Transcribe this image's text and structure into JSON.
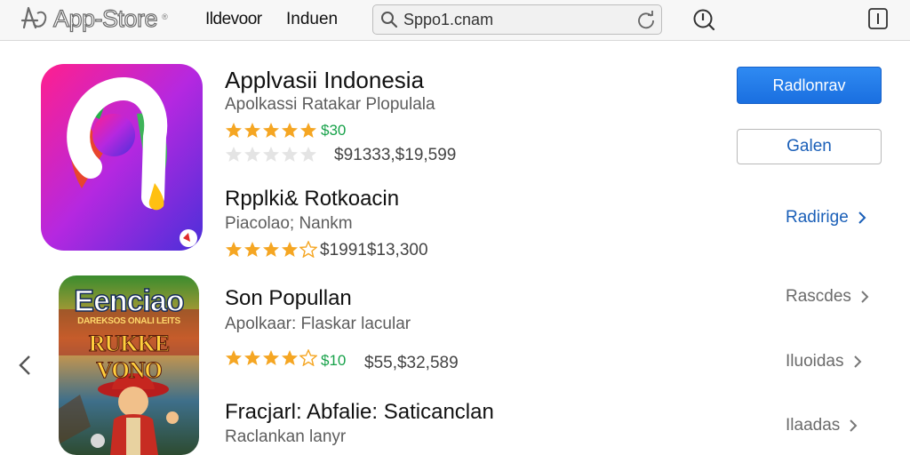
{
  "header": {
    "brand": "App-Store",
    "brand_mark": "®",
    "nav": [
      "Ildevoor",
      "Induen"
    ],
    "search": {
      "value": "Sppo1.cnam",
      "placeholder": ""
    }
  },
  "apps": [
    {
      "title": "Applvasii Indonesia",
      "subtitle": "Apolkassi Ratakar Plopulala",
      "rating_a": 5,
      "price_a": "$30",
      "rating_b": 0,
      "price_b": "$91333,$19,599",
      "primary_action": "Radlonrav",
      "secondary_action": "Galen"
    },
    {
      "title": "Rpplki& Rotkoacin",
      "subtitle": "Piacolao; Nankm",
      "rating": 4.5,
      "price": "$1991$13,300",
      "action": "Radirige"
    },
    {
      "title": "Son Popullan",
      "subtitle": "Apolkaar: Flaskar lacular",
      "rating": 4.5,
      "price_green": "$10",
      "price": "$55,$32,589",
      "action": "Rascdes",
      "action2": "Iluoidas"
    },
    {
      "title": "Fracjarl: Abfalie: Saticanclan",
      "subtitle": "Raclankan lanyr",
      "action": "Ilaadas"
    }
  ],
  "featured_icon": {
    "title": "Eenciao",
    "subtitle": "DAREKSOS ONALI LEITS",
    "heading": "RUKKE VONO"
  },
  "colors": {
    "accent_blue": "#1a6fe0",
    "link_blue": "#1a5fb8",
    "star": "#f5a623",
    "price_green": "#18a24a"
  },
  "icons": [
    "app-store-logo-icon",
    "search-icon",
    "refresh-icon",
    "info-icon",
    "menu-icon",
    "chevron-right-icon",
    "chevron-left-icon",
    "star-icon"
  ]
}
